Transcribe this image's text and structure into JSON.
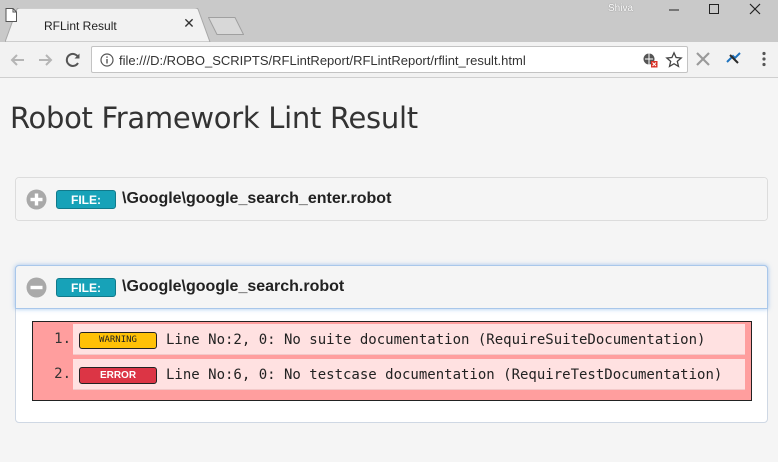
{
  "browser": {
    "tab_title": "RFLint Result",
    "tab_close_label": "✕",
    "profile_name": "Shiva",
    "url": "file:///D:/ROBO_SCRIPTS/RFLintReport/RFLintReport/rflint_result.html"
  },
  "page": {
    "title": "Robot Framework Lint Result",
    "files": [
      {
        "badge": "FILE:",
        "path": "\\Google\\google_search_enter.robot",
        "expanded": false
      },
      {
        "badge": "FILE:",
        "path": "\\Google\\google_search.robot",
        "expanded": true,
        "issues": [
          {
            "number": "1.",
            "severity": "WARNING",
            "message": "Line No:2, 0: No suite documentation (RequireSuiteDocumentation)"
          },
          {
            "number": "2.",
            "severity": "ERROR",
            "message": "Line No:6, 0: No testcase documentation (RequireTestDocumentation)"
          }
        ]
      }
    ]
  },
  "colors": {
    "file_badge": "#17a2b8",
    "warning_badge": "#ffc107",
    "error_badge": "#dc3545",
    "issues_background": "#ff9e9e",
    "issue_row_background": "#ffe1e1"
  }
}
